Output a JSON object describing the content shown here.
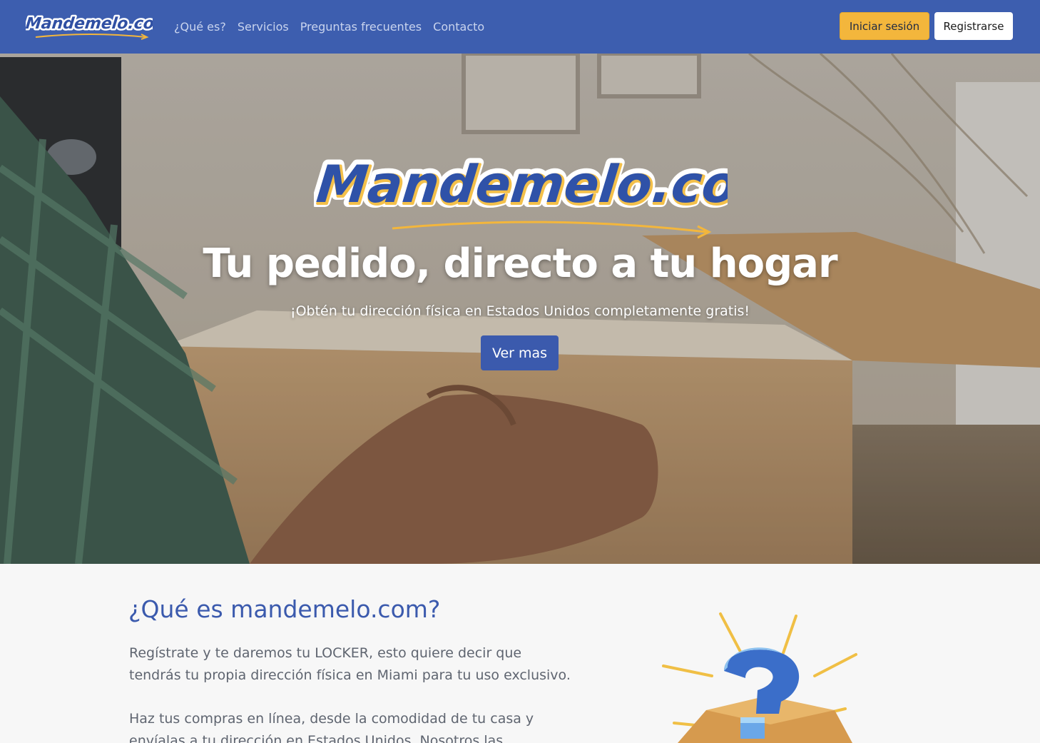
{
  "navbar": {
    "logo_text": "Mandemelo.com",
    "links": [
      "¿Qué es?",
      "Servicios",
      "Preguntas frecuentes",
      "Contacto"
    ],
    "login_label": "Iniciar sesión",
    "register_label": "Registrarse"
  },
  "hero": {
    "logo_text": "Mandemelo.com",
    "title": "Tu pedido, directo a tu hogar",
    "subtitle": "¡Obtén tu dirección física en Estados Unidos completamente gratis!",
    "cta_label": "Ver mas"
  },
  "about": {
    "heading": "¿Qué es mandemelo.com?",
    "paragraph1": "Regístrate y te daremos tu LOCKER, esto quiere decir que tendrás tu propia dirección física en Miami para tu uso exclusivo.",
    "paragraph2": "Haz tus compras en línea, desde la comodidad de tu casa y envíalas a tu dirección en Estados Unidos. Nosotros las"
  },
  "colors": {
    "brand_blue": "#3d5eaf",
    "accent_yellow": "#f3b63c",
    "text_gray": "#5f6570"
  }
}
